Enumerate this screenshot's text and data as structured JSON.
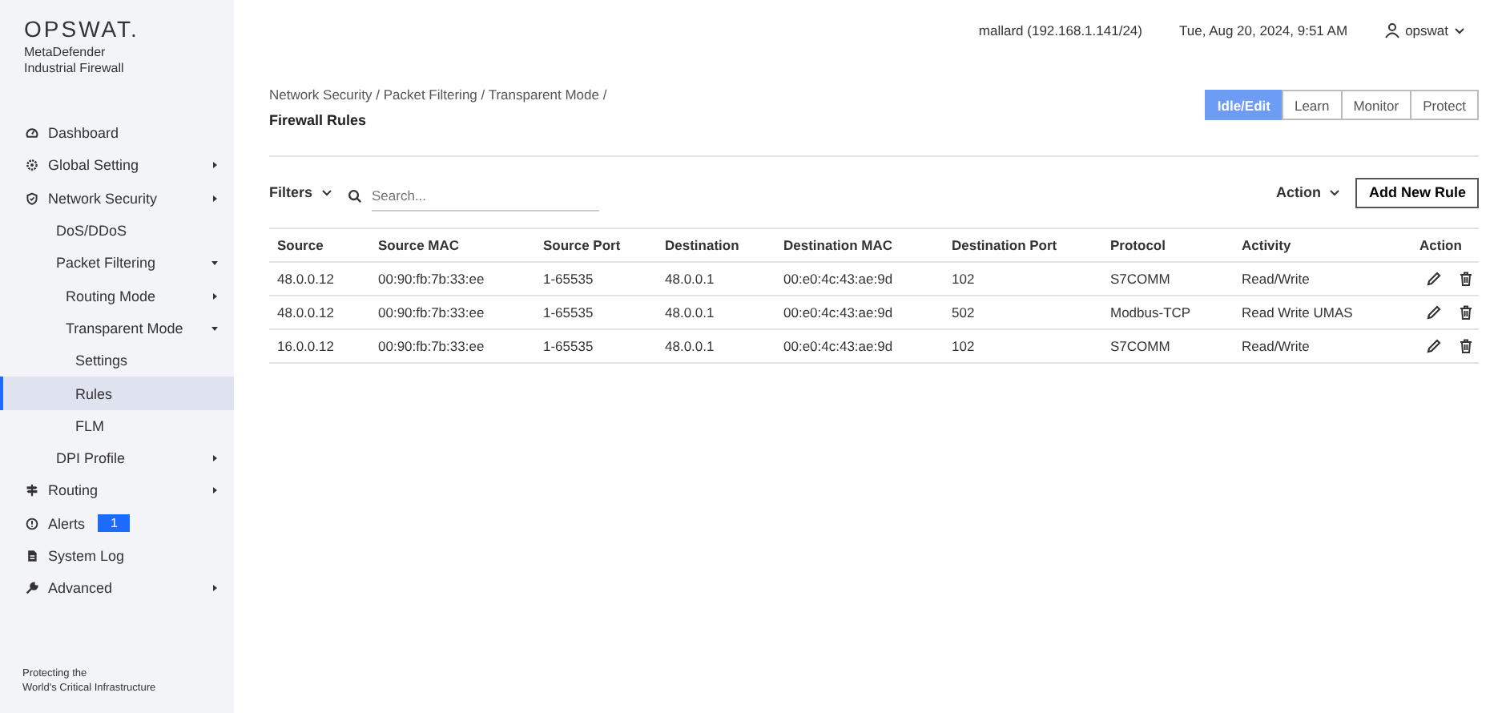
{
  "brand": {
    "logo": "OPSWAT.",
    "product_line1": "MetaDefender",
    "product_line2": "Industrial Firewall"
  },
  "sidebar": {
    "items": [
      {
        "label": "Dashboard",
        "selected": false
      },
      {
        "label": "Global Setting",
        "selected": false,
        "expanded": false
      },
      {
        "label": "Network Security",
        "selected": false,
        "expanded": false,
        "children": [
          {
            "label": "DoS/DDoS",
            "selected": false
          },
          {
            "label": "Packet Filtering",
            "selected": false,
            "expanded": true,
            "children": [
              {
                "label": "Routing Mode",
                "selected": false,
                "expanded": false
              },
              {
                "label": "Transparent Mode",
                "selected": false,
                "expanded": true,
                "children": [
                  {
                    "label": "Settings",
                    "selected": false
                  },
                  {
                    "label": "Rules",
                    "selected": true
                  },
                  {
                    "label": "FLM",
                    "selected": false
                  }
                ]
              }
            ]
          },
          {
            "label": "DPI Profile",
            "selected": false,
            "expanded": false
          }
        ]
      },
      {
        "label": "Routing",
        "selected": false,
        "expanded": false
      },
      {
        "label": "Alerts",
        "selected": false,
        "badge": "1"
      },
      {
        "label": "System Log",
        "selected": false
      },
      {
        "label": "Advanced",
        "selected": false,
        "expanded": false
      }
    ],
    "footer_line1": "Protecting the",
    "footer_line2": "World's Critical Infrastructure"
  },
  "header": {
    "host": "mallard (192.168.1.141/24)",
    "datetime": "Tue, Aug 20, 2024, 9:51 AM",
    "user": "opswat"
  },
  "breadcrumb": "Network Security / Packet Filtering / Transparent Mode /",
  "page_title": "Firewall Rules",
  "modes": [
    {
      "label": "Idle/Edit",
      "selected": true
    },
    {
      "label": "Learn",
      "selected": false
    },
    {
      "label": "Monitor",
      "selected": false
    },
    {
      "label": "Protect",
      "selected": false
    }
  ],
  "toolbar": {
    "filters": "Filters",
    "search": {
      "placeholder": "Search..."
    },
    "action": "Action",
    "add_button": "Add New Rule"
  },
  "table": {
    "columns": [
      "Source",
      "Source MAC",
      "Source Port",
      "Destination",
      "Destination MAC",
      "Destination Port",
      "Protocol",
      "Activity",
      "Action"
    ],
    "rows": [
      [
        "48.0.0.12",
        "00:90:fb:7b:33:ee",
        "1-65535",
        "48.0.0.1",
        "00:e0:4c:43:ae:9d",
        "102",
        "S7COMM",
        "Read/Write"
      ],
      [
        "48.0.0.12",
        "00:90:fb:7b:33:ee",
        "1-65535",
        "48.0.0.1",
        "00:e0:4c:43:ae:9d",
        "502",
        "Modbus-TCP",
        "Read Write UMAS"
      ],
      [
        "16.0.0.12",
        "00:90:fb:7b:33:ee",
        "1-65535",
        "48.0.0.1",
        "00:e0:4c:43:ae:9d",
        "102",
        "S7COMM",
        "Read/Write"
      ]
    ]
  }
}
